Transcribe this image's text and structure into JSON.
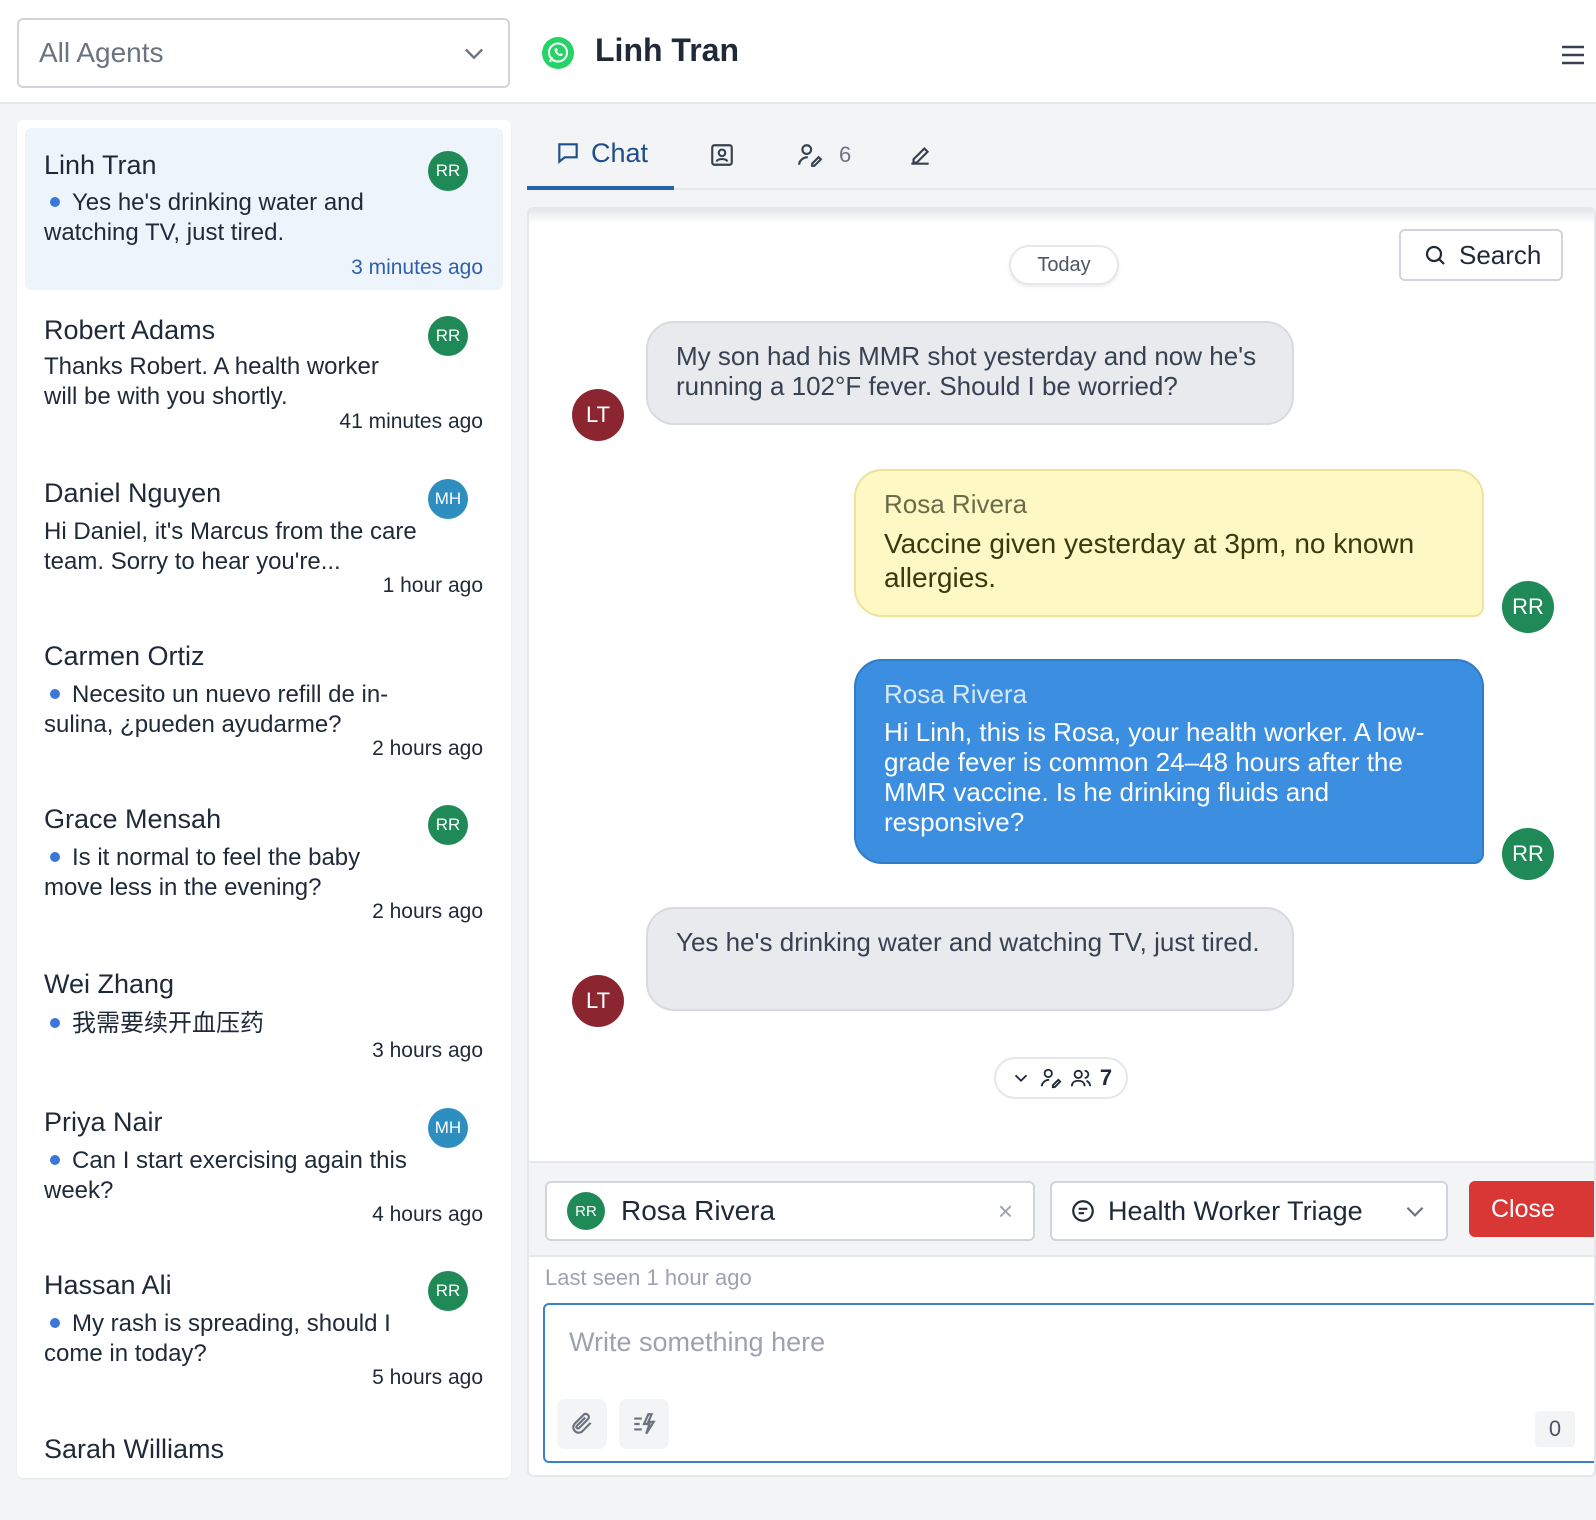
{
  "header": {
    "agent_filter": "All Agents",
    "contact_name": "Linh Tran"
  },
  "conversations": [
    {
      "name": "Linh Tran",
      "preview": "Yes he's drinking water and watching TV, just tired.",
      "time": "3 minutes ago",
      "agent": "RR",
      "unread": true,
      "active": true
    },
    {
      "name": "Robert Adams",
      "preview": "Thanks Robert. A health worker will be with you shortly.",
      "time": "41 minutes ago",
      "agent": "RR",
      "unread": false
    },
    {
      "name": "Daniel Nguyen",
      "preview": "Hi Daniel, it's Marcus from the care team. Sorry to hear you're...",
      "time": "1 hour ago",
      "agent": "MH",
      "unread": false
    },
    {
      "name": "Carmen Ortiz",
      "preview": "Necesito un nuevo refill de in-sulina, ¿pueden ayudarme?",
      "time": "2 hours ago",
      "agent": "",
      "unread": true
    },
    {
      "name": "Grace Mensah",
      "preview": "Is it normal to feel the baby move less in the evening?",
      "time": "2 hours ago",
      "agent": "RR",
      "unread": true
    },
    {
      "name": "Wei Zhang",
      "preview": "我需要续开血压药",
      "time": "3 hours ago",
      "agent": "",
      "unread": true
    },
    {
      "name": "Priya Nair",
      "preview": "Can I start exercising again this week?",
      "time": "4 hours ago",
      "agent": "MH",
      "unread": true
    },
    {
      "name": "Hassan Ali",
      "preview": "My rash is spreading, should I come in today?",
      "time": "5 hours ago",
      "agent": "RR",
      "unread": true
    },
    {
      "name": "Sarah Williams",
      "preview": "",
      "time": "",
      "agent": "",
      "unread": false
    }
  ],
  "tabs": {
    "chat": "Chat",
    "tasks_count": "6"
  },
  "chat": {
    "date_divider": "Today",
    "search_label": "Search",
    "messages": [
      {
        "type": "incoming",
        "avatar": "LT",
        "text": "My son had his MMR shot yesterday and now he's running a 102°F fever. Should I be worried?"
      },
      {
        "type": "note",
        "avatar": "RR",
        "sender": "Rosa Rivera",
        "text": "Vaccine given yesterday at 3pm, no known allergies."
      },
      {
        "type": "outgoing",
        "avatar": "RR",
        "sender": "Rosa Rivera",
        "text": "Hi Linh, this is Rosa, your health worker. A low-grade fever is common 24–48 hours after the MMR vaccine. Is he drinking fluids and responsive?"
      },
      {
        "type": "incoming",
        "avatar": "LT",
        "text": "Yes he's drinking water and watching TV, just tired."
      }
    ],
    "reaction_count": "7"
  },
  "composer": {
    "assignee_initials": "RR",
    "assignee_name": "Rosa Rivera",
    "clear_glyph": "×",
    "queue": "Health Worker Triage",
    "close_label": "Close",
    "last_seen": "Last seen 1 hour ago",
    "placeholder": "Write something here",
    "char_count": "0"
  },
  "colors": {
    "accent": "#2563a8",
    "outgoing_bubble": "#3b8ee0",
    "note_bubble": "#fdf8c4",
    "close_button": "#d93636",
    "agent_rr": "#1f8a57",
    "agent_mh": "#2e8ec0",
    "contact_avatar": "#8b2631"
  },
  "icons": [
    "chevron-down-icon",
    "whatsapp-icon",
    "menu-icon",
    "chat-icon",
    "contact-card-icon",
    "tasks-icon",
    "edit-icon",
    "search-icon",
    "users-icon",
    "queue-icon",
    "paperclip-icon",
    "quick-reply-icon"
  ]
}
